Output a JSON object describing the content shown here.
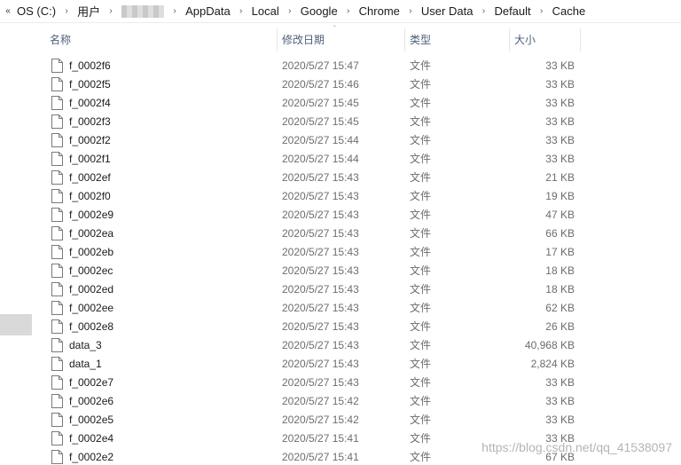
{
  "breadcrumb": {
    "prefix": "«",
    "items": [
      {
        "label": "OS (C:)",
        "redacted": false
      },
      {
        "label": "用户",
        "redacted": false
      },
      {
        "label": "",
        "redacted": true
      },
      {
        "label": "AppData",
        "redacted": false
      },
      {
        "label": "Local",
        "redacted": false
      },
      {
        "label": "Google",
        "redacted": false
      },
      {
        "label": "Chrome",
        "redacted": false
      },
      {
        "label": "User Data",
        "redacted": false
      },
      {
        "label": "Default",
        "redacted": false
      },
      {
        "label": "Cache",
        "redacted": false
      }
    ],
    "separator": "›"
  },
  "columns": {
    "name": "名称",
    "date": "修改日期",
    "type": "类型",
    "size": "大小",
    "sort_indicator": "ˇ"
  },
  "files": [
    {
      "name": "f_0002f6",
      "date": "2020/5/27 15:47",
      "type": "文件",
      "size": "33 KB"
    },
    {
      "name": "f_0002f5",
      "date": "2020/5/27 15:46",
      "type": "文件",
      "size": "33 KB"
    },
    {
      "name": "f_0002f4",
      "date": "2020/5/27 15:45",
      "type": "文件",
      "size": "33 KB"
    },
    {
      "name": "f_0002f3",
      "date": "2020/5/27 15:45",
      "type": "文件",
      "size": "33 KB"
    },
    {
      "name": "f_0002f2",
      "date": "2020/5/27 15:44",
      "type": "文件",
      "size": "33 KB"
    },
    {
      "name": "f_0002f1",
      "date": "2020/5/27 15:44",
      "type": "文件",
      "size": "33 KB"
    },
    {
      "name": "f_0002ef",
      "date": "2020/5/27 15:43",
      "type": "文件",
      "size": "21 KB"
    },
    {
      "name": "f_0002f0",
      "date": "2020/5/27 15:43",
      "type": "文件",
      "size": "19 KB"
    },
    {
      "name": "f_0002e9",
      "date": "2020/5/27 15:43",
      "type": "文件",
      "size": "47 KB"
    },
    {
      "name": "f_0002ea",
      "date": "2020/5/27 15:43",
      "type": "文件",
      "size": "66 KB"
    },
    {
      "name": "f_0002eb",
      "date": "2020/5/27 15:43",
      "type": "文件",
      "size": "17 KB"
    },
    {
      "name": "f_0002ec",
      "date": "2020/5/27 15:43",
      "type": "文件",
      "size": "18 KB"
    },
    {
      "name": "f_0002ed",
      "date": "2020/5/27 15:43",
      "type": "文件",
      "size": "18 KB"
    },
    {
      "name": "f_0002ee",
      "date": "2020/5/27 15:43",
      "type": "文件",
      "size": "62 KB"
    },
    {
      "name": "f_0002e8",
      "date": "2020/5/27 15:43",
      "type": "文件",
      "size": "26 KB"
    },
    {
      "name": "data_3",
      "date": "2020/5/27 15:43",
      "type": "文件",
      "size": "40,968 KB"
    },
    {
      "name": "data_1",
      "date": "2020/5/27 15:43",
      "type": "文件",
      "size": "2,824 KB"
    },
    {
      "name": "f_0002e7",
      "date": "2020/5/27 15:43",
      "type": "文件",
      "size": "33 KB"
    },
    {
      "name": "f_0002e6",
      "date": "2020/5/27 15:42",
      "type": "文件",
      "size": "33 KB"
    },
    {
      "name": "f_0002e5",
      "date": "2020/5/27 15:42",
      "type": "文件",
      "size": "33 KB"
    },
    {
      "name": "f_0002e4",
      "date": "2020/5/27 15:41",
      "type": "文件",
      "size": "33 KB"
    },
    {
      "name": "f_0002e2",
      "date": "2020/5/27 15:41",
      "type": "文件",
      "size": "67 KB"
    }
  ],
  "watermark": "https://blog.csdn.net/qq_41538097",
  "icons": {
    "file": "file-icon",
    "separator": "chevron-right-icon",
    "prefix": "double-chevron-left-icon"
  },
  "colors": {
    "header_text": "#4c607a",
    "secondary_text": "#6d6d6d",
    "nav_selected": "#d9d9d9"
  }
}
